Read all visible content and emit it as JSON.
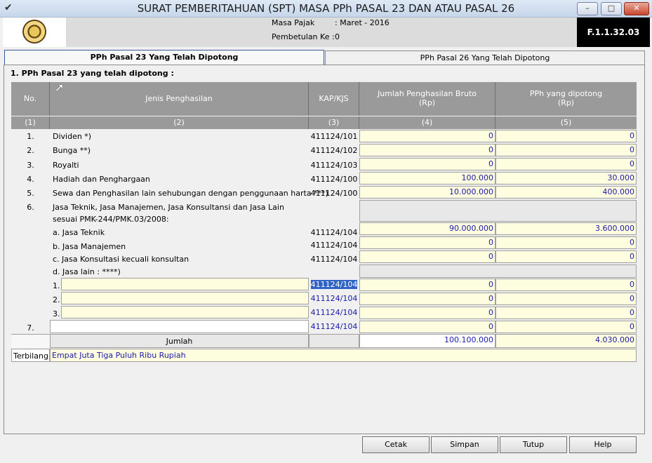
{
  "window": {
    "title": "SURAT PEMBERITAHUAN (SPT) MASA PPh PASAL 23 DAN ATAU PASAL 26",
    "min": "–",
    "max": "□",
    "close": "✕"
  },
  "header": {
    "masa_pajak_label": "Masa Pajak",
    "masa_pajak_value": ":    Maret - 2016",
    "pembetulan_label": "Pembetulan Ke :",
    "pembetulan_value": "0",
    "form_code": "F.1.1.32.03"
  },
  "tabs": [
    {
      "label": "PPh Pasal 23 Yang Telah Dipotong",
      "active": true
    },
    {
      "label": "PPh Pasal 26 Yang Telah Dipotong",
      "active": false
    }
  ],
  "section_title": "1. PPh Pasal 23 yang telah dipotong :",
  "table": {
    "headers": {
      "no": "No.",
      "jenis": "Jenis Penghasilan",
      "kap": "KAP/KJS",
      "bruto_1": "Jumlah Penghasilan Bruto",
      "bruto_2": "(Rp)",
      "pph_1": "PPh yang dipotong",
      "pph_2": "(Rp)"
    },
    "col_numbers": [
      "(1)",
      "(2)",
      "(3)",
      "(4)",
      "(5)"
    ],
    "rows": [
      {
        "no": "1.",
        "jenis": "Dividen *)",
        "kap": "411124/101",
        "bruto": "0",
        "pph": "0"
      },
      {
        "no": "2.",
        "jenis": "Bunga  **)",
        "kap": "411124/102",
        "bruto": "0",
        "pph": "0"
      },
      {
        "no": "3.",
        "jenis": "Royalti",
        "kap": "411124/103",
        "bruto": "0",
        "pph": "0"
      },
      {
        "no": "4.",
        "jenis": "Hadiah dan Penghargaan",
        "kap": "411124/100",
        "bruto": "100.000",
        "pph": "30.000"
      },
      {
        "no": "5.",
        "jenis": "Sewa dan Penghasilan lain sehubungan dengan penggunaan harta ***)",
        "kap": "411124/100",
        "bruto": "10.000.000",
        "pph": "400.000"
      }
    ],
    "row6": {
      "no": "6.",
      "line1": "Jasa Teknik, Jasa Manajemen,  Jasa Konsultansi dan Jasa Lain",
      "line2": "sesuai PMK-244/PMK.03/2008:",
      "subs": [
        {
          "label": "a. Jasa Teknik",
          "kap": "411124/104",
          "bruto": "90.000.000",
          "pph": "3.600.000"
        },
        {
          "label": "b. Jasa Manajemen",
          "kap": "411124/104",
          "bruto": "0",
          "pph": "0"
        },
        {
          "label": "c. Jasa Konsultasi kecuali konsultan",
          "kap": "411124/104",
          "bruto": "0",
          "pph": "0"
        }
      ],
      "lain_label": "d. Jasa lain : ****)",
      "lain": [
        {
          "no": "1.",
          "kap": "411124/104",
          "bruto": "0",
          "pph": "0"
        },
        {
          "no": "2.",
          "kap": "411124/104",
          "bruto": "0",
          "pph": "0"
        },
        {
          "no": "3.",
          "kap": "411124/104",
          "bruto": "0",
          "pph": "0"
        }
      ]
    },
    "row7": {
      "no": "7.",
      "kap": "411124/104",
      "bruto": "0",
      "pph": "0"
    },
    "total": {
      "label": "Jumlah",
      "bruto": "100.100.000",
      "pph": "4.030.000"
    },
    "terbilang": {
      "label": "Terbilang",
      "value": "Empat Juta Tiga Puluh Ribu Rupiah"
    }
  },
  "buttons": {
    "cetak": "Cetak",
    "simpan": "Simpan",
    "tutup": "Tutup",
    "help": "Help"
  },
  "colors": {
    "value_text": "#1a1aa8",
    "input_bg": "#fffde0",
    "header_bg": "#9a9a9a"
  }
}
